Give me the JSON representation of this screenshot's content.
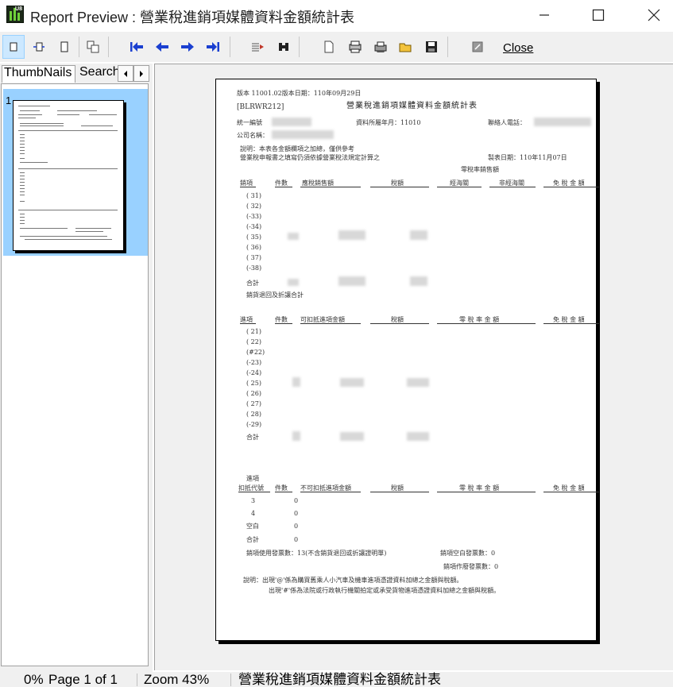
{
  "window": {
    "title": "Report Preview : 營業稅進銷項媒體資料金額統計表",
    "icon_tag": "U8"
  },
  "toolbar": {
    "close_label": "Close",
    "buttons": [
      "one-page-icon",
      "page-width-icon",
      "full-page-icon",
      "multi-page-icon",
      "first-page-icon",
      "prev-page-icon",
      "next-page-icon",
      "last-page-icon",
      "goto-page-icon",
      "search-icon",
      "new-icon",
      "print-setup-icon",
      "print-icon",
      "open-icon",
      "save-icon",
      "export-icon"
    ]
  },
  "left_panel": {
    "tabs": [
      "ThumbNails",
      "Search"
    ],
    "thumbnail_number": "1"
  },
  "report": {
    "version": "版本 11001.02版本日期：110年09月29日",
    "code": "[BLRWR212]",
    "title": "營業稅進銷項媒體資料金額統計表",
    "tax_id_label": "統一編號",
    "period_label": "資料所屬年月：11010",
    "phone_label": "聯絡人電話：",
    "company_label": "公司名稱：",
    "note1": "說明：本表各金額欄項之加總，僅供參考",
    "note2": "營業稅申報書之填寫仍須依據營業稅法規定計算之",
    "print_date": "製表日期：110年11月07日",
    "zero_rate_header": "零稅率銷售額",
    "sales_headers": [
      "銷項",
      "件數",
      "應稅銷售額",
      "稅額",
      "經海關",
      "非經海關",
      "免 稅 金 額"
    ],
    "sales_codes": [
      "( 31)",
      "( 32)",
      "(-33)",
      "(-34)",
      "( 35)",
      "( 36)",
      "( 37)",
      "(-38)"
    ],
    "subtotal_label": "合計",
    "sales_return_label": "銷貨退回及折讓合計",
    "input_headers": [
      "進項",
      "件數",
      "可扣抵進項金額",
      "稅額",
      "零 稅 率 金 額",
      "免 稅 金 額"
    ],
    "input_codes": [
      "( 21)",
      "( 22)",
      "(#22)",
      "(-23)",
      "(-24)",
      "( 25)",
      "( 26)",
      "( 27)",
      "( 28)",
      "(-29)"
    ],
    "nondeduct_top_label": "進項",
    "nondeduct_headers": [
      "扣抵代號",
      "件數",
      "不可扣抵進項金額",
      "稅額",
      "零 稅 率 金 額",
      "免 稅 金 額"
    ],
    "nondeduct_rows": [
      {
        "code": "3",
        "count": "0"
      },
      {
        "code": "4",
        "count": "0"
      },
      {
        "code": "空白",
        "count": "0"
      },
      {
        "code": "合計",
        "count": "0"
      }
    ],
    "invoice_used": "銷項使用發票數：13(不含銷貨退回或折讓證明單)",
    "invoice_blank": "銷項空白發票數：0",
    "invoice_void": "銷項作廢發票數：0",
    "footer_note1": "說明：出現'@'係為購買舊乘人小汽車及機車進項憑證資料加總之金額與稅額。",
    "footer_note2": "出現'#'係為法院或行政執行機關拍定或承受貨物進項憑證資料加總之金額與稅額。"
  },
  "status": {
    "progress": "0%",
    "page": "Page 1 of 1",
    "zoom": "Zoom 43%",
    "report_name": "營業稅進銷項媒體資料金額統計表"
  }
}
